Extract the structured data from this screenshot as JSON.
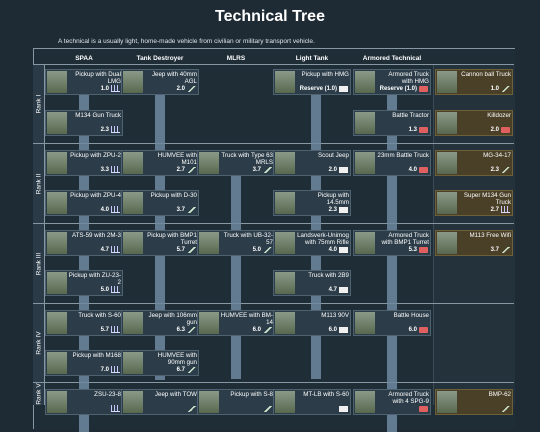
{
  "title": "Technical Tree",
  "description": "A technical is a usually light, home-made vehicle from civilian or military transport vehicle.",
  "columns": [
    "SPAA",
    "Tank Destroyer",
    "MLRS",
    "Light Tank",
    "Armored Technical"
  ],
  "ranks": [
    "Rank I",
    "Rank II",
    "Rank III",
    "Rank IV",
    "Rank V"
  ],
  "colors": {
    "background": "#1e2b34",
    "card": "#2c3d49",
    "premium_card": "#4a3f27",
    "arrow": "#6f8aa0"
  },
  "cards": [
    {
      "name": "Pickup with Dual LMG",
      "br": "1.0",
      "icon": "spaa-icon"
    },
    {
      "name": "Jeep with 40mm AGL",
      "br": "2.0",
      "icon": "at-icon"
    },
    {
      "name": "Pickup with HMG",
      "br": "Reserve (1.0)",
      "icon": "light-tank-icon"
    },
    {
      "name": "Armored Truck with HMG",
      "br": "Reserve (1.0)",
      "icon": "armored-icon"
    },
    {
      "name": "Cannon ball Truck",
      "br": "1.0",
      "icon": "at-icon",
      "premium": true
    },
    {
      "name": "M134 Gun Truck",
      "br": "2.3",
      "icon": "spaa-icon"
    },
    {
      "name": "Battle Tractor",
      "br": "1.3",
      "icon": "armored-icon"
    },
    {
      "name": "Killdozer",
      "br": "2.0",
      "icon": "armored-icon",
      "premium": true
    },
    {
      "name": "Pickup with ZPU-2",
      "br": "3.3",
      "icon": "spaa-icon"
    },
    {
      "name": "HUMVEE with M101",
      "br": "2.7",
      "icon": "at-icon"
    },
    {
      "name": "Truck with Type 63 MRLS",
      "br": "3.7",
      "icon": "at-icon"
    },
    {
      "name": "Scout Jeep",
      "br": "2.0",
      "icon": "light-tank-icon"
    },
    {
      "name": "23mm Battle Truck",
      "br": "4.0",
      "icon": "armored-icon"
    },
    {
      "name": "MG-34-17",
      "br": "2.3",
      "icon": "at-icon",
      "premium": true
    },
    {
      "name": "Pickup with ZPU-4",
      "br": "4.0",
      "icon": "spaa-icon"
    },
    {
      "name": "Pickup with D-30",
      "br": "3.7",
      "icon": "at-icon"
    },
    {
      "name": "Pickup with 14.5mm",
      "br": "2.3",
      "icon": "light-tank-icon"
    },
    {
      "name": "Super M134 Gun Truck",
      "br": "2.7",
      "icon": "spaa-icon",
      "premium": true
    },
    {
      "name": "ATS-59 with 2M-3",
      "br": "4.7",
      "icon": "spaa-icon"
    },
    {
      "name": "Pickup with BMP1 Turret",
      "br": "5.7",
      "icon": "at-icon"
    },
    {
      "name": "Truck with UB-32-57",
      "br": "5.0",
      "icon": "at-icon"
    },
    {
      "name": "Landsverk-Unimog with 75mm Rifle",
      "br": "4.0",
      "icon": "light-tank-icon"
    },
    {
      "name": "Armored Truck with BMP1 Turret",
      "br": "5.3",
      "icon": "armored-icon"
    },
    {
      "name": "M113 Free Wifi",
      "br": "3.7",
      "icon": "at-icon",
      "premium": true
    },
    {
      "name": "Pickup with ZU-23-2",
      "br": "5.0",
      "icon": "spaa-icon"
    },
    {
      "name": "Truck with 2B9",
      "br": "4.7",
      "icon": "light-tank-icon"
    },
    {
      "name": "Truck with S-60",
      "br": "5.7",
      "icon": "spaa-icon"
    },
    {
      "name": "Jeep with 106mm gun",
      "br": "6.3",
      "icon": "at-icon"
    },
    {
      "name": "HUMVEE with BM-14",
      "br": "6.0",
      "icon": "at-icon"
    },
    {
      "name": "M113 90V",
      "br": "6.0",
      "icon": "light-tank-icon"
    },
    {
      "name": "Battle House",
      "br": "6.0",
      "icon": "armored-icon"
    },
    {
      "name": "Pickup with M168",
      "br": "7.0",
      "icon": "spaa-icon"
    },
    {
      "name": "HUMVEE with 90mm gun",
      "br": "6.7",
      "icon": "at-icon"
    },
    {
      "name": "ZSU-23-8",
      "br": "",
      "icon": "spaa-icon"
    },
    {
      "name": "Jeep with TOW",
      "br": "",
      "icon": "at-icon"
    },
    {
      "name": "Pickup with S-8",
      "br": "",
      "icon": "at-icon"
    },
    {
      "name": "MT-LB with S-60",
      "br": "",
      "icon": "light-tank-icon"
    },
    {
      "name": "Armored Truck with 4 SPG-9",
      "br": "",
      "icon": "armored-icon"
    },
    {
      "name": "BMP-62",
      "br": "",
      "icon": "at-icon",
      "premium": true
    }
  ]
}
